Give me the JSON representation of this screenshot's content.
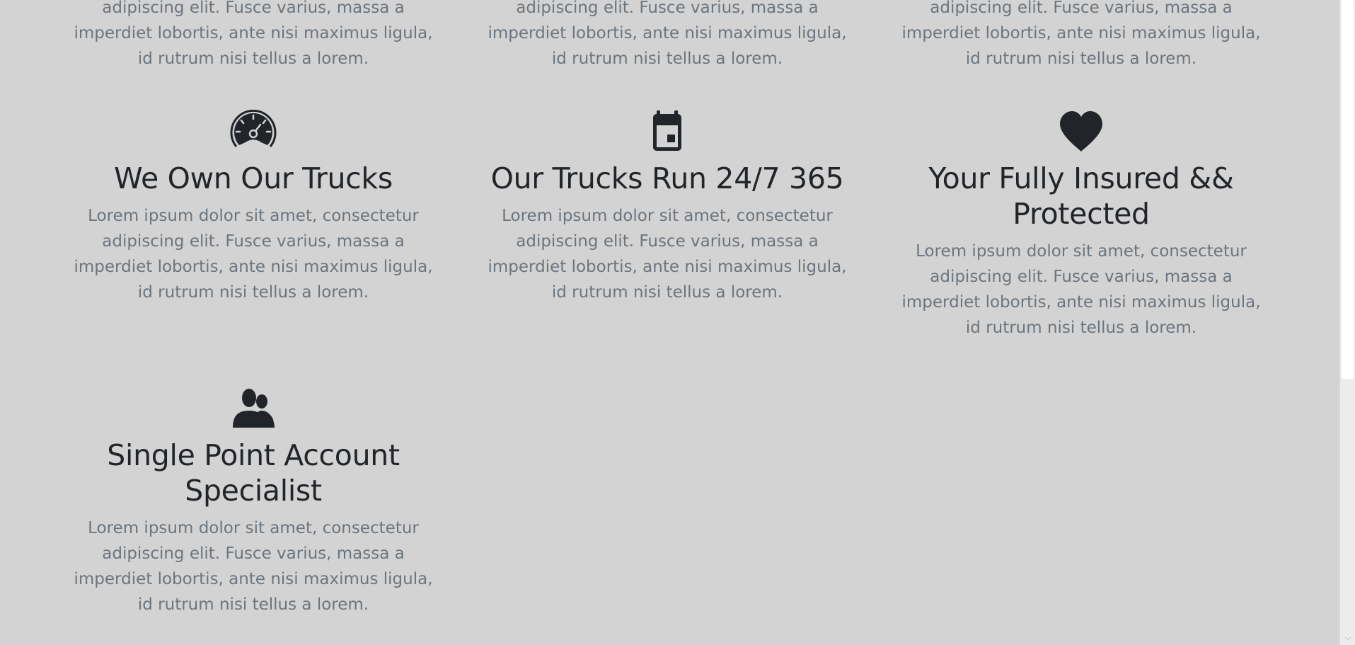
{
  "top_row": {
    "items": [
      {
        "text": "adipiscing elit. Fusce varius, massa a imperdiet lobortis, ante nisi maximus ligula, id rutrum nisi tellus a lorem."
      },
      {
        "text": "adipiscing elit. Fusce varius, massa a imperdiet lobortis, ante nisi maximus ligula, id rutrum nisi tellus a lorem."
      },
      {
        "text": "adipiscing elit. Fusce varius, massa a imperdiet lobortis, ante nisi maximus ligula, id rutrum nisi tellus a lorem."
      }
    ]
  },
  "features": [
    {
      "icon": "speedometer-icon",
      "title": "We Own Our Trucks",
      "text": "Lorem ipsum dolor sit amet, consectetur adipiscing elit. Fusce varius, massa a imperdiet lobortis, ante nisi maximus ligula, id rutrum nisi tellus a lorem."
    },
    {
      "icon": "calendar-icon",
      "title": "Our Trucks Run 24/7 365",
      "text": "Lorem ipsum dolor sit amet, consectetur adipiscing elit. Fusce varius, massa a imperdiet lobortis, ante nisi maximus ligula, id rutrum nisi tellus a lorem."
    },
    {
      "icon": "heart-icon",
      "title": "Your Fully Insured && Protected",
      "text": "Lorem ipsum dolor sit amet, consectetur adipiscing elit. Fusce varius, massa a imperdiet lobortis, ante nisi maximus ligula, id rutrum nisi tellus a lorem."
    },
    {
      "icon": "users-icon",
      "title": "Single Point Account Specialist",
      "text": "Lorem ipsum dolor sit amet, consectetur adipiscing elit. Fusce varius, massa a imperdiet lobortis, ante nisi maximus ligula, id rutrum nisi tellus a lorem."
    }
  ],
  "colors": {
    "background": "#d3d3d3",
    "heading": "#212529",
    "body_text": "#6c757d",
    "icon": "#212529"
  }
}
